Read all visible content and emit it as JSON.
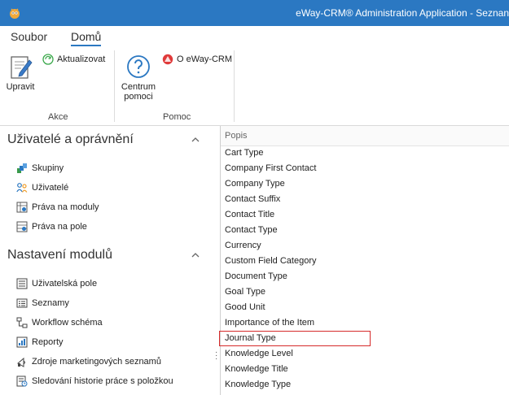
{
  "window": {
    "title": "eWay-CRM® Administration Application - Seznan"
  },
  "ribbon": {
    "tabs": [
      {
        "label": "Soubor"
      },
      {
        "label": "Domů"
      }
    ],
    "groups": {
      "akce": {
        "label": "Akce",
        "edit_label": "Upravit",
        "refresh_label": "Aktualizovat"
      },
      "pomoc": {
        "label": "Pomoc",
        "help_line1": "Centrum",
        "help_line2": "pomoci",
        "about_label": "O eWay-CRM"
      }
    }
  },
  "sidebar": {
    "sections": [
      {
        "title": "Uživatelé a oprávnění",
        "items": [
          {
            "label": "Skupiny",
            "icon": "groups-icon"
          },
          {
            "label": "Uživatelé",
            "icon": "users-icon"
          },
          {
            "label": "Práva na moduly",
            "icon": "module-rights-icon"
          },
          {
            "label": "Práva na pole",
            "icon": "field-rights-icon"
          }
        ]
      },
      {
        "title": "Nastavení modulů",
        "items": [
          {
            "label": "Uživatelská pole",
            "icon": "user-fields-icon"
          },
          {
            "label": "Seznamy",
            "icon": "lists-icon"
          },
          {
            "label": "Workflow schéma",
            "icon": "workflow-icon"
          },
          {
            "label": "Reporty",
            "icon": "reports-icon"
          },
          {
            "label": "Zdroje marketingových seznamů",
            "icon": "marketing-sources-icon"
          },
          {
            "label": "Sledování historie práce s položkou",
            "icon": "history-tracking-icon"
          }
        ]
      }
    ]
  },
  "list": {
    "header": "Popis",
    "rows": [
      "Cart Type",
      "Company First Contact",
      "Company Type",
      "Contact Suffix",
      "Contact Title",
      "Contact Type",
      "Currency",
      "Custom Field Category",
      "Document Type",
      "Goal Type",
      "Good Unit",
      "Importance of the Item",
      "Journal Type",
      "Knowledge Level",
      "Knowledge Title",
      "Knowledge Type"
    ],
    "selected": "Journal Type"
  },
  "colors": {
    "title_bar": "#2b78c2",
    "selection_border": "#d62b2b"
  }
}
